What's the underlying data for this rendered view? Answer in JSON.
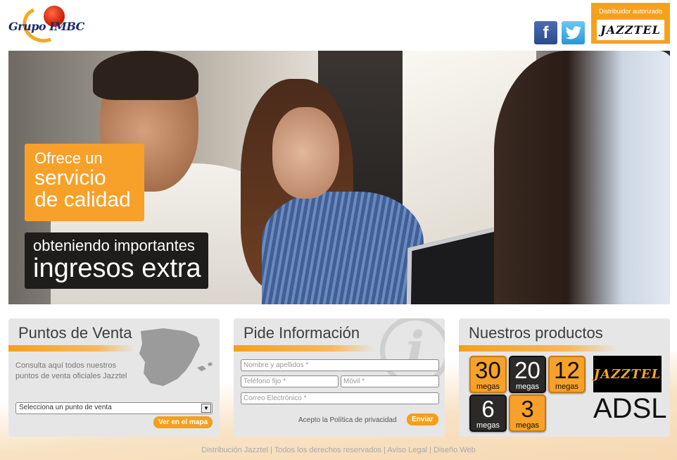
{
  "header": {
    "logo_text": "Grupo IMBC",
    "social": {
      "facebook_label": "f",
      "facebook_icon": "facebook-icon",
      "twitter_icon": "twitter-icon"
    },
    "distributor": {
      "label": "Distribuidor autorizado",
      "brand": "JAZZTEL"
    }
  },
  "hero": {
    "orange_line1": "Ofrece un",
    "orange_line2": "servicio",
    "orange_line3": "de calidad",
    "black_line1": "obteniendo importantes",
    "black_line2": "ingresos extra"
  },
  "puntos": {
    "title": "Puntos de Venta",
    "description": "Consulta aquí todos nuestros puntos de venta oficiales Jazztel",
    "select_value": "Selecciona un punto de venta",
    "map_button": "Ver en el mapa"
  },
  "info": {
    "title": "Pide Información",
    "icon_glyph": "i",
    "name_placeholder": "Nombre y apellidos *",
    "phone_placeholder": "Teléfono fijo *",
    "mobile_placeholder": "Móvil *",
    "email_placeholder": "Correo Electrónico *",
    "privacy_text": "Acepto la Política de privacidad",
    "send_button": "Enviar"
  },
  "productos": {
    "title": "Nuestros productos",
    "tiles": [
      {
        "num": "30",
        "unit": "megas"
      },
      {
        "num": "20",
        "unit": "megas"
      },
      {
        "num": "12",
        "unit": "megas"
      },
      {
        "num": "6",
        "unit": "megas"
      },
      {
        "num": "3",
        "unit": "megas"
      }
    ],
    "brand": "JAZZTEL",
    "adsl": "ADSL"
  },
  "footer": {
    "text": "Distribución Jazztel | Todos los derechos reservados | Aviso Legal | Diseño Web"
  },
  "colors": {
    "accent": "#f59f1c",
    "dark": "#1f1d1c",
    "panel": "#e6e6e6"
  }
}
